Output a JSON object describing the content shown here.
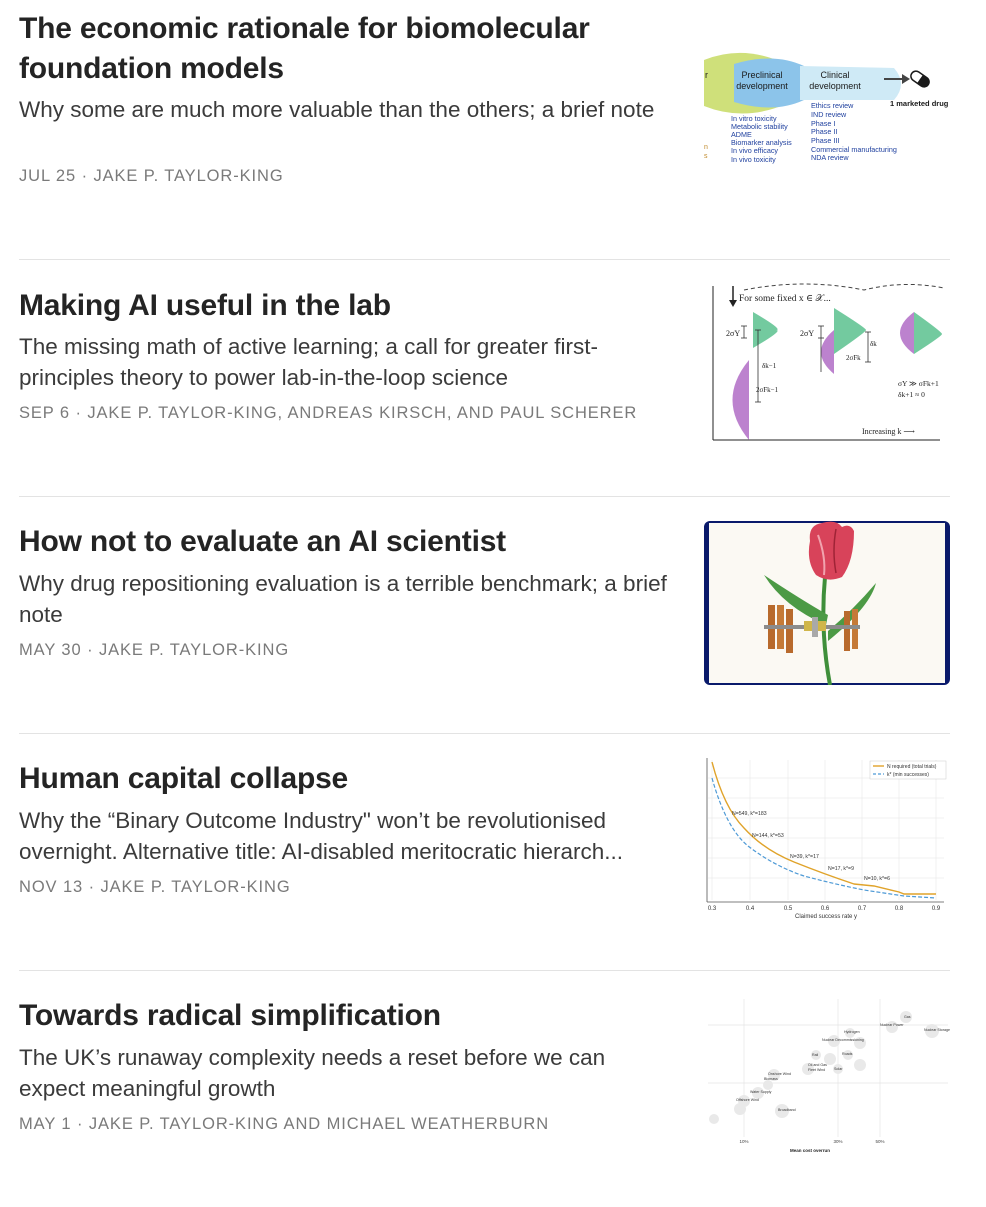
{
  "posts": [
    {
      "title": "The economic rationale for biomolecular foundation models",
      "subtitle": "Why some are much more valuable than the others; a brief note",
      "date": "JUL 25",
      "authors": "JAKE P. TAYLOR-KING",
      "thumbnail": {
        "stage_left_fragment": "r",
        "stage_preclinical": [
          "Preclinical",
          "development"
        ],
        "stage_clinical": [
          "Clinical",
          "development"
        ],
        "output_label": "1 marketed drug",
        "preclinical_items": [
          "In vitro toxicity",
          "Metabolic stability",
          "ADME",
          "Biomarker analysis",
          "In vivo efficacy",
          "In vivo toxicity"
        ],
        "clinical_items": [
          "Ethics review",
          "IND review",
          "Phase I",
          "Phase II",
          "Phase III",
          "Commercial manufacturing",
          "NDA review"
        ],
        "left_edge_fragments": [
          "n",
          "s"
        ],
        "colors": {
          "yellow": "#cfe07a",
          "blue": "#8cc4ea",
          "light_blue": "#cfeaf6",
          "text_blue": "#1e3f9e"
        }
      }
    },
    {
      "title": "Making AI useful in the lab",
      "subtitle": "The missing math of active learning; a call for greater first-principles theory to power lab-in-the-loop science",
      "date": "SEP 6",
      "authors": "JAKE P. TAYLOR-KING, ANDREAS KIRSCH, AND PAUL SCHERER",
      "thumbnail": {
        "header": "For some fixed x ∈ 𝒳...",
        "labels": [
          "2σY",
          "2σY",
          "δk−1",
          "2σFk−1",
          "2σFk",
          "δk"
        ],
        "footnote": [
          "σY ≫ σFk+1",
          "δk+1 ≈ 0"
        ],
        "axis_label": "Increasing k ⟶",
        "colors": {
          "green": "#5ac18e",
          "purple": "#b06cc6"
        }
      }
    },
    {
      "title": "How not to evaluate an AI scientist",
      "subtitle": "Why drug repositioning evaluation is a terrible benchmark; a brief note",
      "date": "MAY 30",
      "authors": "JAKE P. TAYLOR-KING",
      "thumbnail": {
        "icon": "tulip-space-station-illustration",
        "colors": {
          "frame": "#0a1a6b",
          "petal": "#d8435a",
          "stem": "#3f8f3a",
          "panel": "#b86a2c"
        }
      }
    },
    {
      "title": "Human capital collapse",
      "subtitle": "Why the “Binary Outcome Industry\" won’t be revolutionised overnight. Alternative title: AI-disabled meritocratic hierarch...",
      "date": "NOV 13",
      "authors": "JAKE P. TAYLOR-KING",
      "thumbnail": {
        "legend": [
          "N required (total trials)",
          "k* (min successes)"
        ],
        "annotations": [
          "N=549, k*=183",
          "N=144, k*=53",
          "N=39, k*=17",
          "N=17, k*=9",
          "N=10, k*=6"
        ],
        "x_ticks": [
          "0.3",
          "0.4",
          "0.5",
          "0.6",
          "0.7",
          "0.8",
          "0.9"
        ],
        "xlabel": "Claimed success rate y",
        "colors": {
          "orange": "#e0a32a",
          "blue": "#4e9ad6"
        }
      }
    },
    {
      "title": "Towards radical simplification",
      "subtitle": "The UK’s runaway complexity needs a reset before we can expect meaningful growth",
      "date": "MAY 1",
      "authors": "JAKE P. TAYLOR-KING AND MICHAEL WEATHERBURN",
      "thumbnail": {
        "point_labels": [
          "Gas",
          "Nuclear Power",
          "Nuclear Storage",
          "Hydrogen",
          "Nuclear Decommissioning",
          "Rail",
          "Roads",
          "Oil and Gas",
          "Fleet Wind",
          "Solar",
          "Onshore Wind",
          "Biomass",
          "Water Supply",
          "Offshore Wind",
          "Broadband"
        ],
        "x_ticks": [
          "10%",
          "30%",
          "50%"
        ],
        "xlabel": "Mean cost overrun"
      }
    }
  ]
}
